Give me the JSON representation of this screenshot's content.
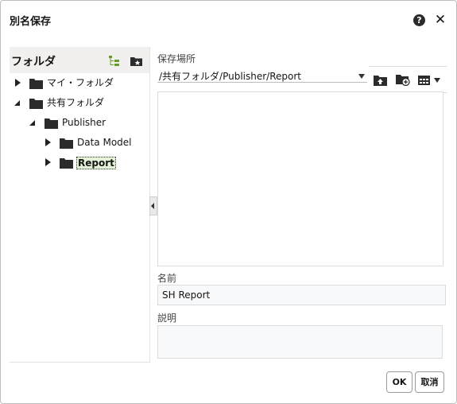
{
  "dialog": {
    "title": "別名保存"
  },
  "folder_panel": {
    "title": "フォルダ",
    "tree": [
      {
        "label": "マイ・フォルダ",
        "expanded": false
      },
      {
        "label": "共有フォルダ",
        "expanded": true
      },
      {
        "label": "Publisher",
        "expanded": true
      },
      {
        "label": "Data Model",
        "expanded": false
      },
      {
        "label": "Report",
        "expanded": false,
        "selected": true
      }
    ]
  },
  "location": {
    "label": "保存場所",
    "path": "/共有フォルダ/Publisher/Report"
  },
  "name_field": {
    "label": "名前",
    "value": "SH Report"
  },
  "description_field": {
    "label": "説明",
    "value": ""
  },
  "buttons": {
    "ok": "OK",
    "cancel": "取消"
  },
  "colors": {
    "tree_icon_green": "#6a9a2b",
    "folder_dark": "#2b2b2b",
    "selection_bg": "#e4f2d9"
  }
}
